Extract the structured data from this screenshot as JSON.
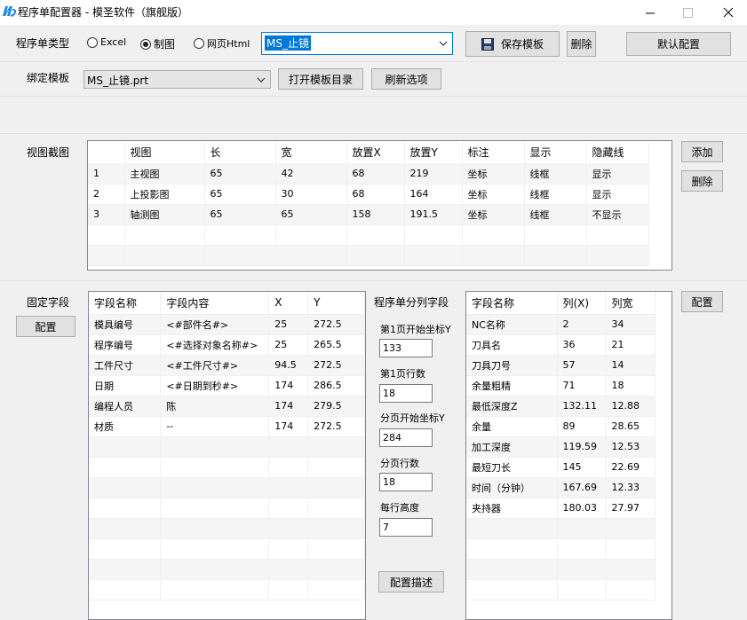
{
  "window": {
    "title": "程序单配置器 - 模圣软件（旗舰版）"
  },
  "top": {
    "type_label": "程序单类型",
    "radio_excel": "Excel",
    "radio_drawing": "制图",
    "radio_html": "网页Html",
    "selected_type": "制图",
    "template_name": "MS_止镜",
    "save_template": "保存模板",
    "delete": "删除",
    "default_config": "默认配置"
  },
  "bind": {
    "label": "绑定模板",
    "value": "MS_止镜.prt",
    "open_dir": "打开模板目录",
    "refresh": "刷新选项"
  },
  "views": {
    "label": "视图截图",
    "add": "添加",
    "delete": "删除",
    "headers": [
      "",
      "视图",
      "长",
      "宽",
      "放置X",
      "放置Y",
      "标注",
      "显示",
      "隐藏线"
    ],
    "rows": [
      [
        "1",
        "主视图",
        "65",
        "42",
        "68",
        "219",
        "坐标",
        "线框",
        "显示"
      ],
      [
        "2",
        "上投影图",
        "65",
        "30",
        "68",
        "164",
        "坐标",
        "线框",
        "显示"
      ],
      [
        "3",
        "轴测图",
        "65",
        "65",
        "158",
        "191.5",
        "坐标",
        "线框",
        "不显示"
      ]
    ]
  },
  "fixed": {
    "label": "固定字段",
    "config": "配置",
    "headers": [
      "字段名称",
      "字段内容",
      "X",
      "Y"
    ],
    "rows": [
      [
        "模具编号",
        "<#部件名#>",
        "25",
        "272.5"
      ],
      [
        "程序编号",
        "<#选择对象名称#>",
        "25",
        "265.5"
      ],
      [
        "工件尺寸",
        "<#工件尺寸#>",
        "94.5",
        "272.5"
      ],
      [
        "日期",
        "<#日期到秒#>",
        "174",
        "286.5"
      ],
      [
        "编程人员",
        "陈",
        "174",
        "279.5"
      ],
      [
        "材质",
        "--",
        "174",
        "272.5"
      ]
    ]
  },
  "split": {
    "title": "程序单分列字段",
    "p1_y_label": "第1页开始坐标Y",
    "p1_y": "133",
    "p1_rows_label": "第1页行数",
    "p1_rows": "18",
    "page_y_label": "分页开始坐标Y",
    "page_y": "284",
    "page_rows_label": "分页行数",
    "page_rows": "18",
    "row_height_label": "每行高度",
    "row_height": "7",
    "describe": "配置描述"
  },
  "columns": {
    "config": "配置",
    "headers": [
      "字段名称",
      "列(X)",
      "列宽"
    ],
    "rows": [
      [
        "NC名称",
        "2",
        "34"
      ],
      [
        "刀具名",
        "36",
        "21"
      ],
      [
        "刀具刀号",
        "57",
        "14"
      ],
      [
        "余量粗精",
        "71",
        "18"
      ],
      [
        "最低深度Z",
        "132.11",
        "12.88"
      ],
      [
        "余量",
        "89",
        "28.65"
      ],
      [
        "加工深度",
        "119.59",
        "12.53"
      ],
      [
        "最短刀长",
        "145",
        "22.69"
      ],
      [
        "时间（分钟）",
        "167.69",
        "12.33"
      ],
      [
        "夹持器",
        "180.03",
        "27.97"
      ]
    ]
  },
  "colors": {
    "logo": "#1e88e5",
    "selection": "#0078d7"
  },
  "icons": [
    "app-logo-icon",
    "minimize-icon",
    "maximize-icon",
    "close-icon",
    "chevron-down-icon",
    "floppy-disk-icon"
  ]
}
